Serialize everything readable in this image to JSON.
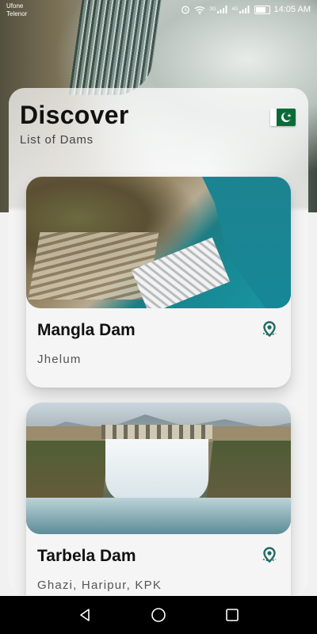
{
  "status_bar": {
    "carrier_1": "Ufone",
    "carrier_2": "Telenor",
    "network_1": "3G",
    "network_2": "4G",
    "time": "14:05 AM",
    "icons": [
      "alarm-icon",
      "wifi-icon",
      "signal-icon",
      "signal-icon",
      "battery-icon"
    ]
  },
  "header": {
    "title": "Discover",
    "subtitle": "List of Dams",
    "flag_icon": "pakistan-flag-icon"
  },
  "dams": [
    {
      "name": "Mangla Dam",
      "location": "Jhelum",
      "icon": "location-pin-icon"
    },
    {
      "name": "Tarbela Dam",
      "location": "Ghazi, Haripur, KPK",
      "icon": "location-pin-icon"
    }
  ],
  "nav": {
    "icons": [
      "back-icon",
      "home-icon",
      "recents-icon"
    ]
  },
  "colors": {
    "accent": "#1f6b63",
    "flag_green": "#0a6b37",
    "title": "#111111"
  }
}
